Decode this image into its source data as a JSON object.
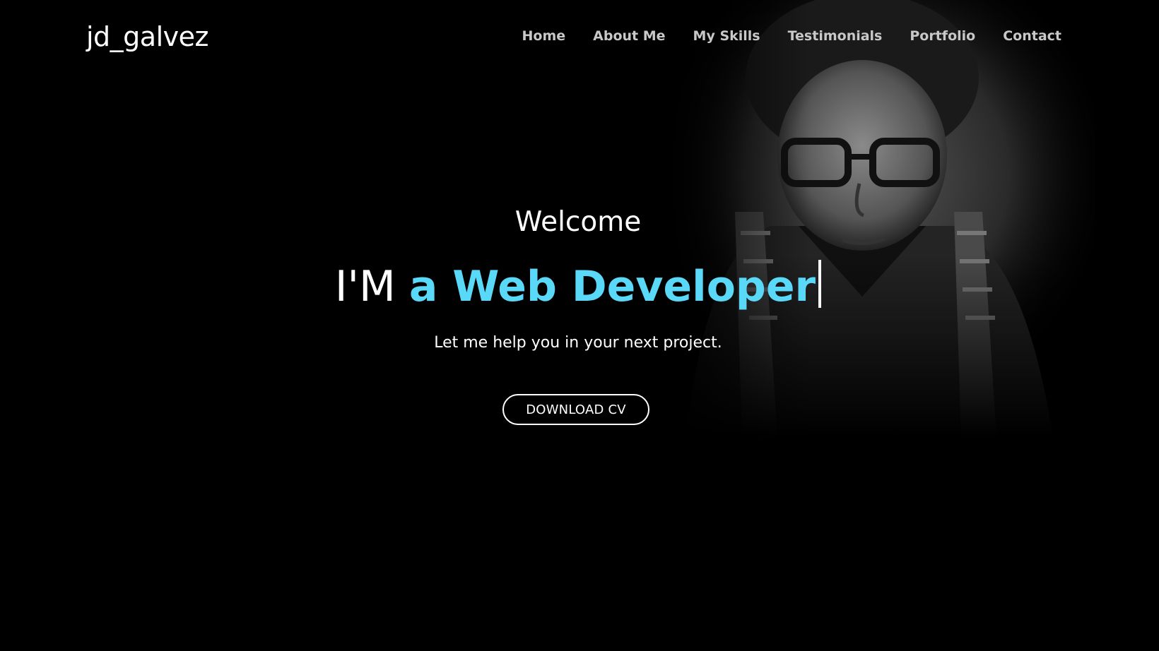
{
  "brand": {
    "logo_text": "jd_galvez"
  },
  "nav": {
    "items": [
      {
        "label": "Home"
      },
      {
        "label": "About Me"
      },
      {
        "label": "My Skills"
      },
      {
        "label": "Testimonials"
      },
      {
        "label": "Portfolio"
      },
      {
        "label": "Contact"
      }
    ]
  },
  "hero": {
    "welcome": "Welcome",
    "headline_lead": "I'M",
    "headline_role": "a Web Developer",
    "tagline": "Let me help you in your next project.",
    "cta_label": "DOWNLOAD CV",
    "accent_color": "#5ad8f8",
    "background_color": "#000000"
  }
}
